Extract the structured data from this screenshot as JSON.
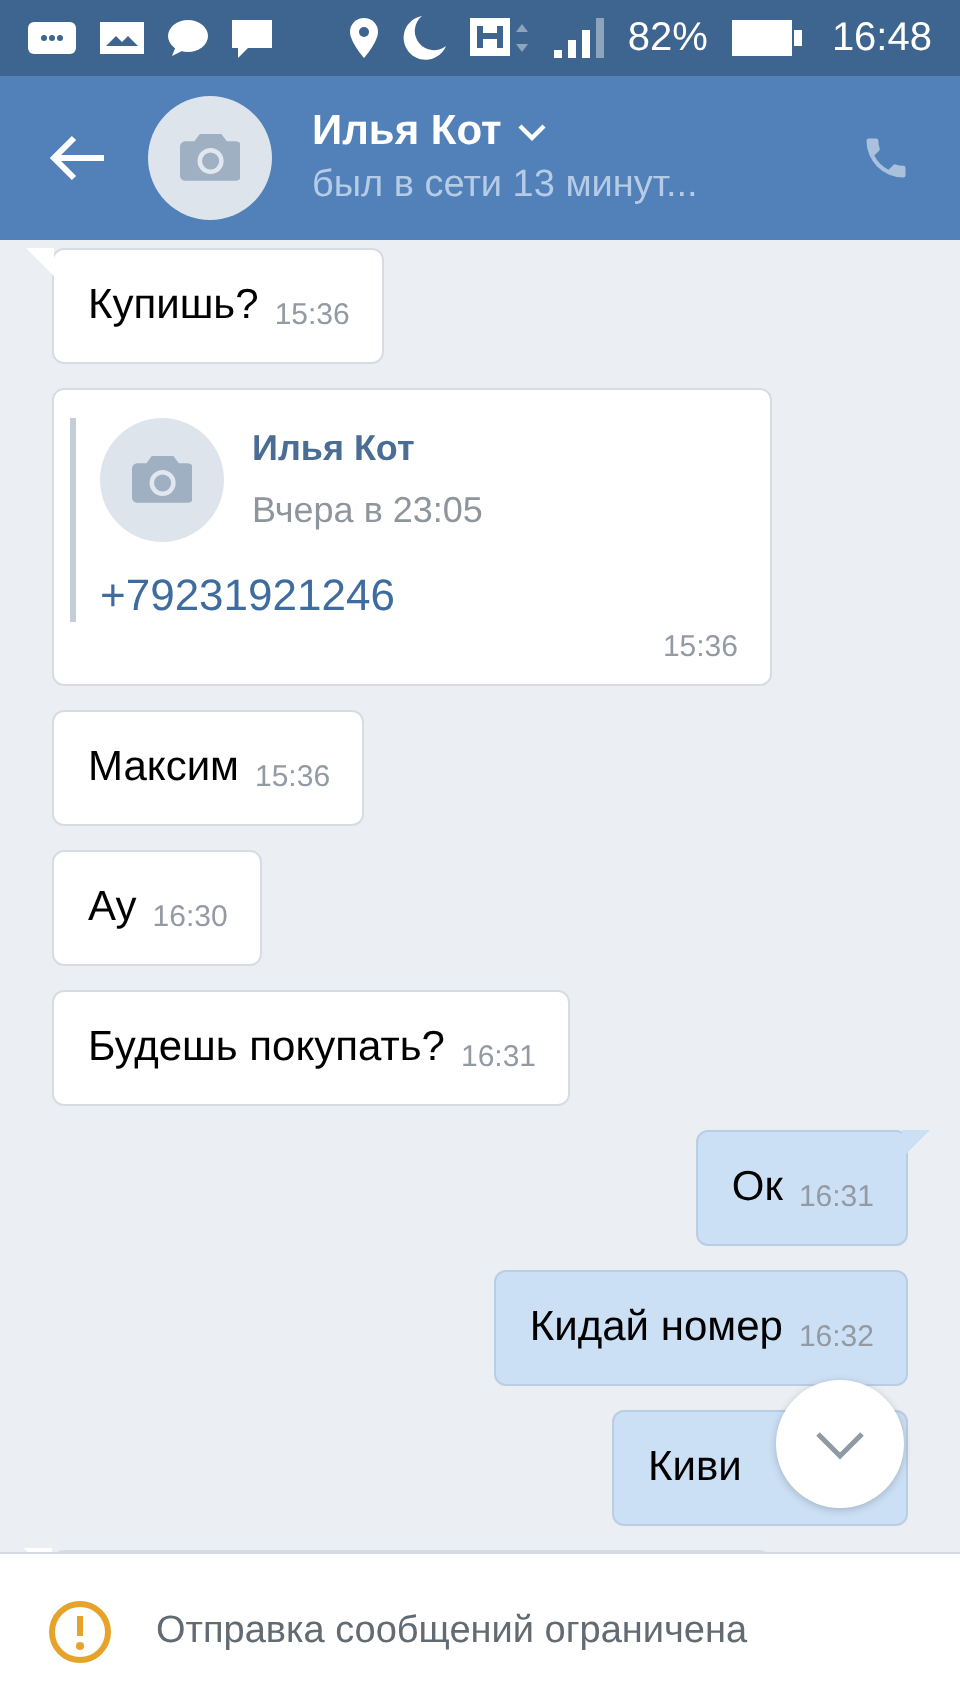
{
  "status_bar": {
    "battery": "82%",
    "time": "16:48"
  },
  "header": {
    "name": "Илья Кот",
    "status": "был в сети 13 минут..."
  },
  "messages": [
    {
      "kind": "text",
      "outgoing": false,
      "tail": true,
      "text": "Купишь?",
      "time": "15:36"
    },
    {
      "kind": "forward",
      "outgoing": false,
      "tail": false,
      "author": "Илья Кот",
      "date": "Вчера в 23:05",
      "text": "+79231921246",
      "time": "15:36"
    },
    {
      "kind": "text",
      "outgoing": false,
      "tail": false,
      "text": "Максим",
      "time": "15:36"
    },
    {
      "kind": "text",
      "outgoing": false,
      "tail": false,
      "text": "Ау",
      "time": "16:30"
    },
    {
      "kind": "text",
      "outgoing": false,
      "tail": false,
      "text": "Будешь покупать?",
      "time": "16:31"
    },
    {
      "kind": "text",
      "outgoing": true,
      "tail": true,
      "text": "Ок",
      "time": "16:31"
    },
    {
      "kind": "text",
      "outgoing": true,
      "tail": false,
      "text": "Кидай номер",
      "time": "16:32"
    },
    {
      "kind": "text",
      "outgoing": true,
      "tail": false,
      "text": "Киви"
    },
    {
      "kind": "cut",
      "outgoing": false,
      "tail": true
    }
  ],
  "notice": {
    "text": "Отправка сообщений ограничена"
  }
}
